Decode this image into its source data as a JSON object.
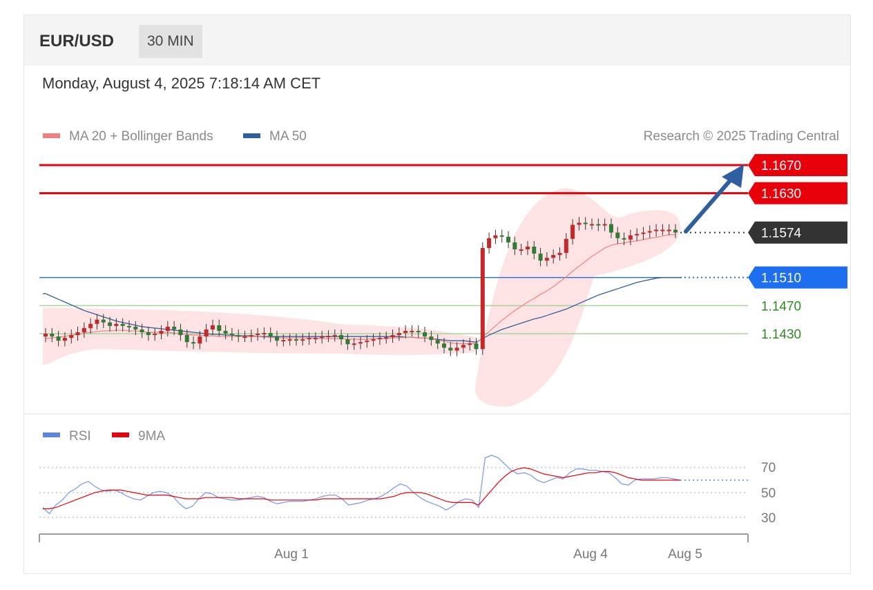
{
  "header": {
    "symbol": "EUR/USD",
    "timeframe": "30 MIN"
  },
  "datetime": "Monday, August 4, 2025 7:18:14 AM CET",
  "legend": [
    {
      "label": "MA 20 + Bollinger Bands",
      "color": "#f08080"
    },
    {
      "label": "MA 50",
      "color": "#2f5f9e"
    }
  ],
  "credit": "Research © 2025 Trading Central",
  "levels": [
    {
      "label": "1.1670",
      "value": 1.167,
      "kind": "resistance",
      "color": "#e8000b"
    },
    {
      "label": "1.1630",
      "value": 1.163,
      "kind": "resistance",
      "color": "#e8000b"
    },
    {
      "label": "1.1574",
      "value": 1.1574,
      "kind": "last",
      "color": "#333333"
    },
    {
      "label": "1.1510",
      "value": 1.151,
      "kind": "pivot",
      "color": "#1e6ff0"
    },
    {
      "label": "1.1470",
      "value": 1.147,
      "kind": "support",
      "color": "#2e8b22"
    },
    {
      "label": "1.1430",
      "value": 1.143,
      "kind": "support",
      "color": "#2e8b22"
    }
  ],
  "rsi_legend": [
    {
      "label": "RSI",
      "color": "#5b85e0"
    },
    {
      "label": "9MA",
      "color": "#e8000b"
    }
  ],
  "rsi_axis": [
    "70",
    "50",
    "30"
  ],
  "x_labels": [
    "Aug 1",
    "Aug 4",
    "Aug 5"
  ],
  "chart_data": {
    "type": "candlestick",
    "price_scale": [
      1.133,
      1.168
    ],
    "close": [
      1.143,
      1.1426,
      1.142,
      1.1424,
      1.1428,
      1.1432,
      1.1438,
      1.1444,
      1.145,
      1.1446,
      1.1441,
      1.1444,
      1.1441,
      1.144,
      1.1436,
      1.1432,
      1.1428,
      1.143,
      1.1434,
      1.144,
      1.1436,
      1.1428,
      1.1418,
      1.1416,
      1.1426,
      1.1436,
      1.1442,
      1.1434,
      1.143,
      1.1428,
      1.1426,
      1.1426,
      1.1428,
      1.143,
      1.1431,
      1.1426,
      1.142,
      1.1421,
      1.1422,
      1.1421,
      1.1422,
      1.1424,
      1.1424,
      1.1426,
      1.1427,
      1.1428,
      1.1422,
      1.1415,
      1.1416,
      1.1418,
      1.142,
      1.1422,
      1.1424,
      1.1425,
      1.1428,
      1.1431,
      1.1434,
      1.1434,
      1.1432,
      1.1426,
      1.1421,
      1.1416,
      1.141,
      1.1406,
      1.141,
      1.1414,
      1.1416,
      1.1408,
      1.1552,
      1.1566,
      1.157,
      1.1568,
      1.156,
      1.155,
      1.155,
      1.1554,
      1.1544,
      1.1534,
      1.1538,
      1.1542,
      1.1545,
      1.1565,
      1.1585,
      1.1588,
      1.1586,
      1.1586,
      1.1584,
      1.1586,
      1.1574,
      1.1566,
      1.1564,
      1.157,
      1.1572,
      1.1574,
      1.1576,
      1.1578,
      1.1578,
      1.1578,
      1.1574
    ],
    "ma20": [
      1.1423,
      1.1424,
      1.1425,
      1.1426,
      1.1428,
      1.1429,
      1.1431,
      1.1432,
      1.1433,
      1.1434,
      1.1434,
      1.1435,
      1.1435,
      1.1434,
      1.1434,
      1.1433,
      1.1432,
      1.1432,
      1.1432,
      1.1432,
      1.1431,
      1.143,
      1.1429,
      1.1428,
      1.1428,
      1.1427,
      1.1427,
      1.1426,
      1.1426,
      1.1426,
      1.1426,
      1.1426,
      1.1426,
      1.1426,
      1.1425,
      1.1425,
      1.1424,
      1.1424,
      1.1424,
      1.1424,
      1.1424,
      1.1424,
      1.1424,
      1.1423,
      1.1423,
      1.1423,
      1.1423,
      1.1422,
      1.1422,
      1.1422,
      1.1422,
      1.1423,
      1.1423,
      1.1423,
      1.1424,
      1.1424,
      1.1425,
      1.1425,
      1.1424,
      1.1424,
      1.1423,
      1.1421,
      1.1419,
      1.1417,
      1.1416,
      1.1416,
      1.1416,
      1.1416,
      1.1425,
      1.1433,
      1.1441,
      1.1449,
      1.1456,
      1.1463,
      1.1469,
      1.1475,
      1.148,
      1.1486,
      1.1491,
      1.1497,
      1.1504,
      1.1511,
      1.1519,
      1.1526,
      1.1533,
      1.154,
      1.1546,
      1.1552,
      1.1556,
      1.1558,
      1.1559,
      1.1561,
      1.1562,
      1.1564,
      1.1566,
      1.1567,
      1.1569,
      1.1571,
      1.1571
    ],
    "ma50": [
      1.1487,
      1.1483,
      1.1479,
      1.1475,
      1.1471,
      1.1467,
      1.1463,
      1.146,
      1.1457,
      1.1454,
      1.1451,
      1.1448,
      1.1446,
      1.1444,
      1.1442,
      1.144,
      1.1439,
      1.1438,
      1.1437,
      1.1436,
      1.1435,
      1.1434,
      1.1433,
      1.1432,
      1.1431,
      1.143,
      1.1429,
      1.1429,
      1.1428,
      1.1428,
      1.1427,
      1.1427,
      1.1427,
      1.1426,
      1.1426,
      1.1426,
      1.1426,
      1.1426,
      1.1426,
      1.1426,
      1.1426,
      1.1426,
      1.1426,
      1.1426,
      1.1426,
      1.1426,
      1.1426,
      1.1426,
      1.1426,
      1.1426,
      1.1426,
      1.1426,
      1.1426,
      1.1426,
      1.1426,
      1.1426,
      1.1425,
      1.1425,
      1.1424,
      1.1424,
      1.1423,
      1.1422,
      1.1421,
      1.142,
      1.142,
      1.142,
      1.1419,
      1.1418,
      1.1423,
      1.1428,
      1.1432,
      1.1436,
      1.1439,
      1.1442,
      1.1445,
      1.1448,
      1.1451,
      1.1453,
      1.1456,
      1.1459,
      1.1462,
      1.1465,
      1.1469,
      1.1473,
      1.1477,
      1.1481,
      1.1485,
      1.1488,
      1.1491,
      1.1494,
      1.1497,
      1.15,
      1.1503,
      1.1505,
      1.1507,
      1.1509,
      1.151,
      1.151,
      1.151
    ],
    "rsi": {
      "ylim": [
        20,
        90
      ],
      "rsi": [
        38,
        33,
        40,
        44,
        50,
        53,
        57,
        59,
        55,
        52,
        51,
        52,
        50,
        47,
        45,
        44,
        47,
        50,
        51,
        50,
        47,
        41,
        37,
        39,
        45,
        50,
        49,
        46,
        45,
        44,
        44,
        45,
        46,
        47,
        46,
        43,
        41,
        42,
        43,
        43,
        43,
        44,
        45,
        47,
        48,
        48,
        45,
        40,
        41,
        42,
        44,
        45,
        47,
        50,
        54,
        57,
        55,
        50,
        46,
        43,
        41,
        39,
        36,
        39,
        43,
        45,
        44,
        38,
        78,
        80,
        78,
        73,
        68,
        65,
        66,
        64,
        60,
        58,
        60,
        62,
        61,
        66,
        69,
        69,
        68,
        68,
        67,
        66,
        62,
        57,
        56,
        60,
        61,
        61,
        61,
        62,
        62,
        61,
        60
      ],
      "ma9": [
        37,
        37,
        38,
        40,
        42,
        44,
        46,
        48,
        50,
        51,
        52,
        52,
        52,
        51,
        50,
        49,
        48,
        48,
        48,
        48,
        47,
        46,
        45,
        45,
        45,
        46,
        46,
        46,
        46,
        46,
        45,
        45,
        45,
        45,
        45,
        44,
        44,
        44,
        44,
        44,
        44,
        44,
        44,
        45,
        45,
        45,
        45,
        45,
        45,
        45,
        45,
        45,
        45,
        46,
        47,
        49,
        50,
        50,
        50,
        49,
        47,
        45,
        43,
        42,
        42,
        42,
        42,
        40,
        46,
        52,
        58,
        63,
        67,
        69,
        70,
        69,
        67,
        65,
        64,
        63,
        62,
        63,
        64,
        65,
        66,
        66,
        67,
        67,
        66,
        64,
        62,
        61,
        60,
        60,
        60,
        60,
        60,
        60,
        60
      ],
      "levels": [
        70,
        50,
        30
      ]
    }
  }
}
